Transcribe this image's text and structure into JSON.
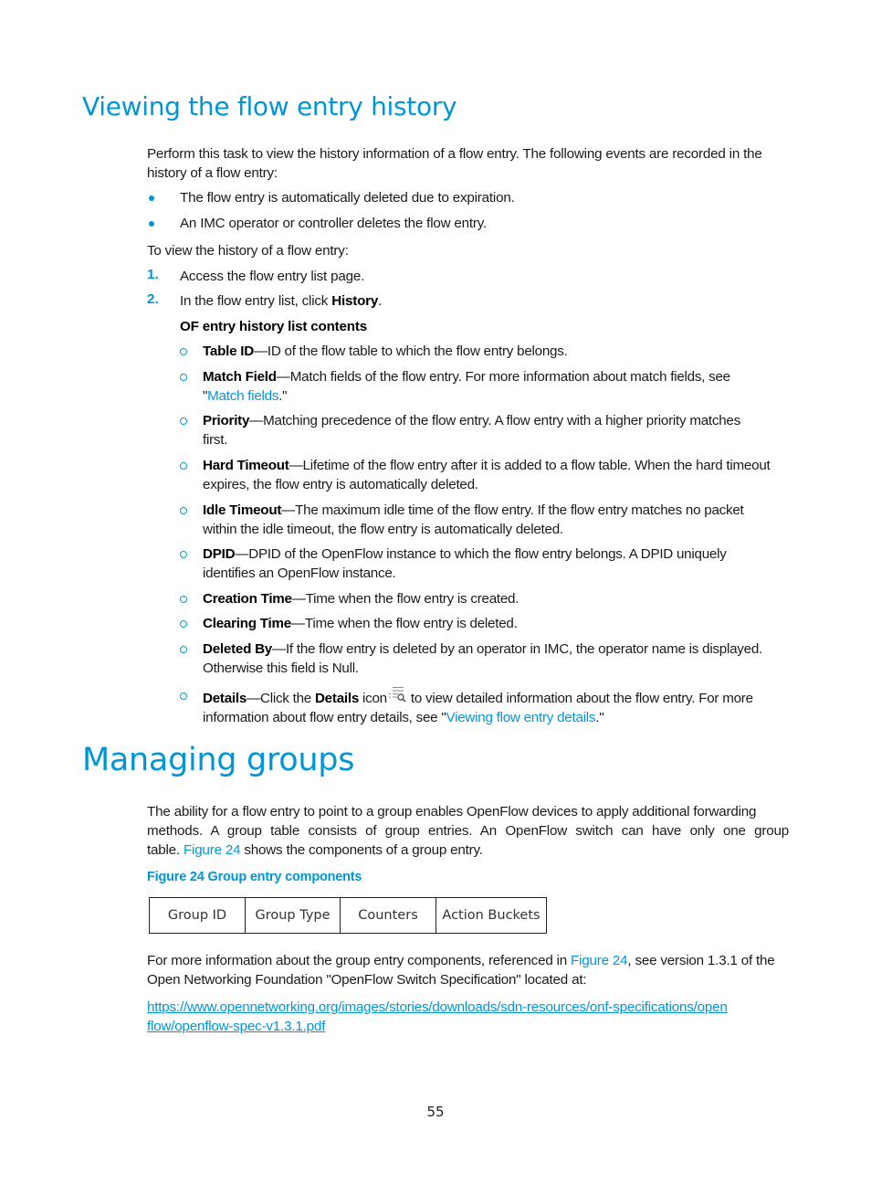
{
  "section1": {
    "title": "Viewing the flow entry history",
    "intro_line1": "Perform this task to view the history information of a flow entry. The following events are recorded in the",
    "intro_line2": "history of a flow entry:",
    "bullets": [
      "The flow entry is automatically deleted due to expiration.",
      "An IMC operator or controller deletes the flow entry."
    ],
    "procedure_intro": "To view the history of a flow entry:",
    "steps": [
      {
        "number": "1.",
        "text": "Access the flow entry list page."
      },
      {
        "number": "2.",
        "text_before": "In the flow entry list, click ",
        "bold": "History",
        "text_after": "."
      }
    ],
    "list_heading": "OF entry history list contents",
    "fields": [
      {
        "term": "Table ID",
        "desc": "—ID of the flow table to which the flow entry belongs."
      },
      {
        "term": "Match Field",
        "desc": "—Match fields of the flow entry. For more information about match fields, see",
        "desc2_before": "\"",
        "link": "Match fields",
        "desc2_after": ".\""
      },
      {
        "term": "Priority",
        "desc": "—Matching precedence of the flow entry. A flow entry with a higher priority matches",
        "desc2": "first."
      },
      {
        "term": "Hard Timeout",
        "desc": "—Lifetime of the flow entry after it is added to a flow table. When the hard timeout",
        "desc2": "expires, the flow entry is automatically deleted."
      },
      {
        "term": "Idle Timeout",
        "desc": "—The maximum idle time of the flow entry. If the flow entry matches no packet",
        "desc2": "within the idle timeout, the flow entry is automatically deleted."
      },
      {
        "term": "DPID",
        "desc": "—DPID of the OpenFlow instance to which the flow entry belongs. A DPID uniquely",
        "desc2": "identifies an OpenFlow instance."
      },
      {
        "term": "Creation Time",
        "desc": "—Time when the flow entry is created."
      },
      {
        "term": "Clearing Time",
        "desc": "—Time when the flow entry is deleted."
      },
      {
        "term": "Deleted By",
        "desc": "—If the flow entry is deleted by an operator in IMC, the operator name is displayed.",
        "desc2": "Otherwise this field is Null."
      },
      {
        "term": "Details",
        "desc_a": "—Click the ",
        "bold": "Details",
        "desc_b": " icon",
        "icon": "details-list-magnifier-icon",
        "desc_c": " to view detailed information about the flow entry. For more",
        "desc2_before": "information about flow entry details, see \"",
        "link": "Viewing flow entry details",
        "desc2_after": ".\""
      }
    ]
  },
  "section2": {
    "title": "Managing groups",
    "para1_line1": "The ability for a flow entry to point to a group enables OpenFlow devices to apply additional forwarding",
    "para1_line2": "methods. A group table consists of group entries. An OpenFlow switch can have only one group",
    "para1_line3_before": "table. ",
    "para1_line3_link": "Figure 24",
    "para1_line3_after": " shows the components of a group entry.",
    "figure_caption": "Figure 24 Group entry components",
    "figure_cells": [
      "Group ID",
      "Group Type",
      "Counters",
      "Action Buckets"
    ],
    "para2_line1_before": "For more information about the group entry components, referenced in ",
    "para2_line1_link": "Figure 24",
    "para2_line1_after": ", see version 1.3.1 of the",
    "para2_line2": "Open Networking Foundation \"OpenFlow Switch Specification\" located at:",
    "url_line1": "https://www.opennetworking.org/images/stories/downloads/sdn-resources/onf-specifications/open",
    "url_line2": "flow/openflow-spec-v1.3.1.pdf"
  },
  "page_number": "55",
  "colors": {
    "accent": "#0096d6",
    "text": "#1a1a1a"
  }
}
